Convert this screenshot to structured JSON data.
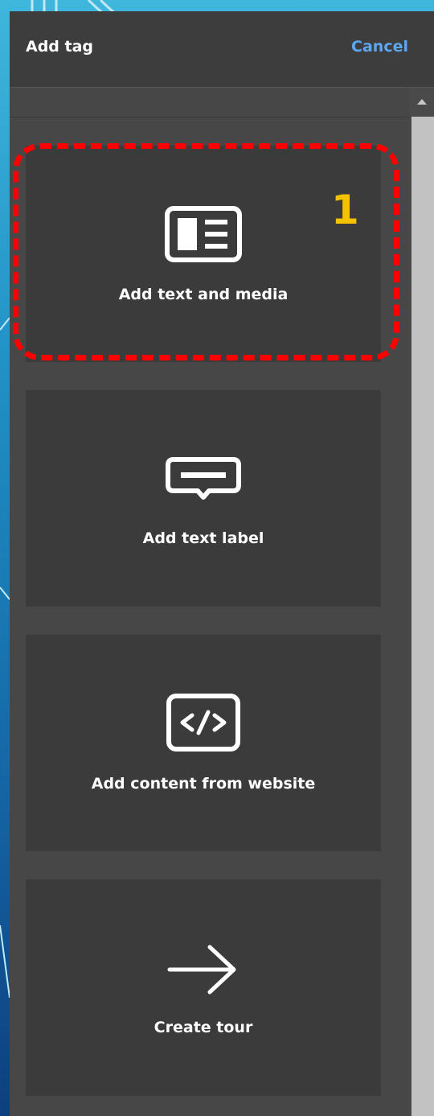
{
  "dialog": {
    "title": "Add tag",
    "cancel_label": "Cancel"
  },
  "options": [
    {
      "label": "Add text and media",
      "icon": "text-media-icon"
    },
    {
      "label": "Add text label",
      "icon": "text-label-icon"
    },
    {
      "label": "Add content from website",
      "icon": "code-icon"
    },
    {
      "label": "Create tour",
      "icon": "arrow-right-icon"
    }
  ],
  "annotation": {
    "step_number": "1",
    "highlight_color": "#ff0000",
    "number_color": "#f5c200"
  },
  "colors": {
    "cancel_link": "#5aa8f5",
    "panel_bg": "#474747",
    "card_bg": "#3b3b3b"
  }
}
